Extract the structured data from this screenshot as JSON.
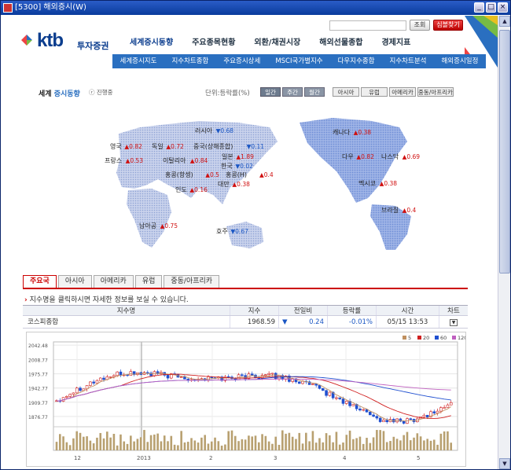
{
  "window": {
    "title": "[5300] 해외증시(W)"
  },
  "header": {
    "logo_text": "ktb",
    "logo_sub": "투자증권",
    "search_placeholder": "",
    "search_button": "조회",
    "symbol_button": "심볼찾기"
  },
  "topnav": [
    "세계증시동향",
    "주요종목현황",
    "외환/채권시장",
    "해외선물종합",
    "경제지표"
  ],
  "subnav": [
    "세계증시지도",
    "지수차트종합",
    "주요증시상세",
    "MSCI국가별지수",
    "다우지수종합",
    "지수차트분석",
    "해외증시일정"
  ],
  "section": {
    "title_a": "세계",
    "title_b": " 증시동향",
    "tag": "ⓡ 진행중",
    "unit": "단위:등락률(%)"
  },
  "period_buttons": [
    "일간",
    "주간",
    "월간"
  ],
  "region_buttons": [
    "아시아",
    "유럽",
    "아메리카",
    "중동/아프리카"
  ],
  "markets": [
    {
      "name": "러시아",
      "dir": "▼",
      "value": "0.68",
      "color": "#1a56c4"
    },
    {
      "name": "영국",
      "dir": "▲",
      "value": "0.82",
      "color": "#d01010"
    },
    {
      "name": "독일",
      "dir": "▲",
      "value": "0.72",
      "color": "#d01010"
    },
    {
      "name": "중국(상해종합)",
      "dir": "▼",
      "value": "0.11",
      "color": "#1a56c4"
    },
    {
      "name": "프랑스",
      "dir": "▲",
      "value": "0.53",
      "color": "#d01010"
    },
    {
      "name": "이탈리아",
      "dir": "▲",
      "value": "0.84",
      "color": "#d01010"
    },
    {
      "name": "일본",
      "dir": "▲",
      "value": "1.89",
      "color": "#d01010"
    },
    {
      "name": "한국",
      "dir": "▼",
      "value": "0.02",
      "color": "#1a56c4"
    },
    {
      "name": "홍콩(항셍)",
      "dir": "▲",
      "value": "0.5",
      "color": "#d01010"
    },
    {
      "name": "홍콩(H)",
      "dir": "▲",
      "value": "0.4",
      "color": "#d01010"
    },
    {
      "name": "대만",
      "dir": "▲",
      "value": "0.38",
      "color": "#d01010"
    },
    {
      "name": "인도",
      "dir": "▲",
      "value": "0.16",
      "color": "#d01010"
    },
    {
      "name": "남아공",
      "dir": "▲",
      "value": "0.75",
      "color": "#d01010"
    },
    {
      "name": "호주",
      "dir": "▼",
      "value": "0.67",
      "color": "#1a56c4"
    },
    {
      "name": "캐나다",
      "dir": "▲",
      "value": "0.38",
      "color": "#d01010"
    },
    {
      "name": "다우",
      "dir": "▲",
      "value": "0.82",
      "color": "#d01010"
    },
    {
      "name": "나스닥",
      "dir": "▲",
      "value": "0.69",
      "color": "#d01010"
    },
    {
      "name": "멕시코",
      "dir": "▲",
      "value": "0.38",
      "color": "#d01010"
    },
    {
      "name": "브라질",
      "dir": "▲",
      "value": "0.4",
      "color": "#d01010"
    }
  ],
  "tabs": [
    "주요국",
    "아시아",
    "아메리카",
    "유럽",
    "중동/아프리카"
  ],
  "hint": "지수명을 클릭하시면 자세한 정보를 보실 수 있습니다.",
  "table": {
    "headers": [
      "지수명",
      "지수",
      "전일비",
      "등락률",
      "시간",
      "차트"
    ],
    "rows": [
      {
        "name": "코스피종합",
        "index": "1968.59",
        "dir": "▼",
        "change": "0.24",
        "rate": "-0.01%",
        "time": "05/15 13:53"
      }
    ]
  },
  "chart_data": {
    "type": "candlestick",
    "legend": [
      "5",
      "20",
      "60",
      "120"
    ],
    "legend_colors": [
      "#c09060",
      "#d02020",
      "#2050d0",
      "#c060c0"
    ],
    "y_ticks": [
      "2042.48",
      "2008.77",
      "1975.77",
      "1942.77",
      "1909.77",
      "1876.77"
    ],
    "ylim": [
      1860,
      2050
    ],
    "x_ticks": [
      "12",
      "2013",
      "2",
      "3",
      "4",
      "5"
    ]
  }
}
